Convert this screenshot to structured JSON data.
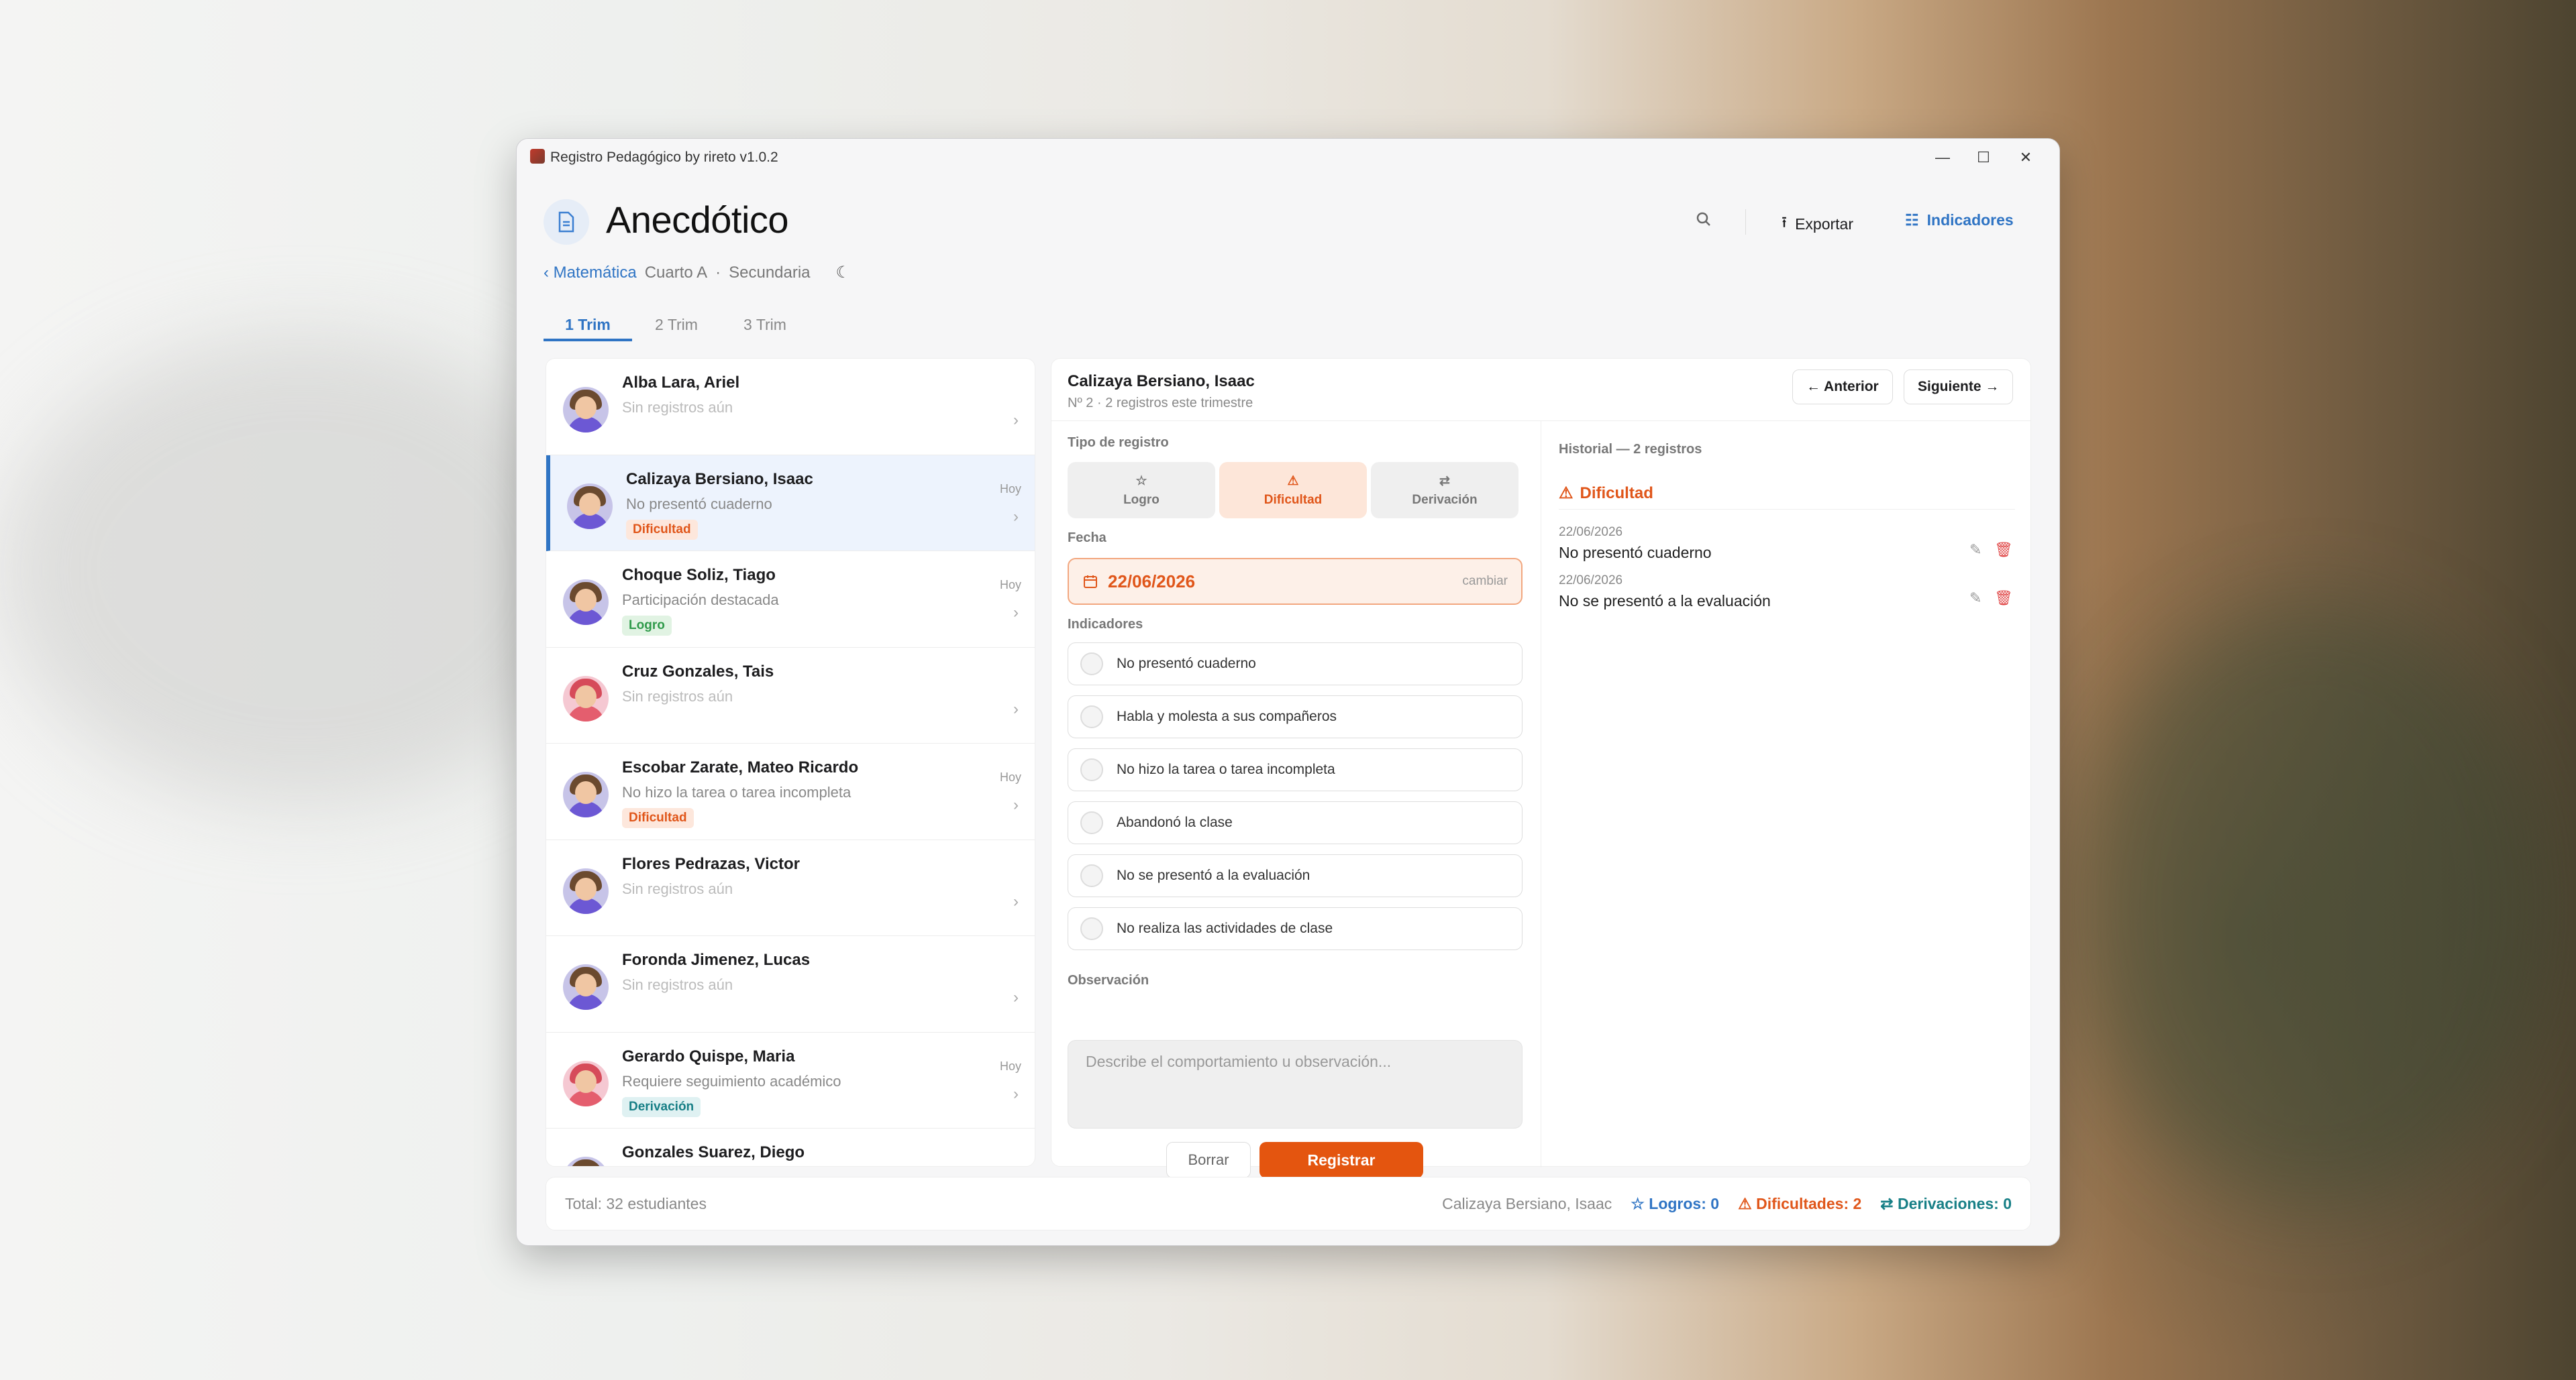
{
  "window": {
    "title": "Registro Pedagógico by rireto v1.0.2",
    "minimize": "—",
    "maximize": "☐",
    "close": "✕"
  },
  "header": {
    "title": "Anecdótico",
    "search_icon": "search-icon",
    "export_label": "Exportar",
    "indicators_label": "Indicadores"
  },
  "breadcrumb": {
    "back": "Matemática",
    "course": "Cuarto A",
    "sep": "·",
    "level": "Secundaria"
  },
  "tabs": [
    "1 Trim",
    "2 Trim",
    "3 Trim"
  ],
  "students": [
    {
      "name": "Alba Lara, Ariel",
      "sub": "Sin registros aún",
      "badge": "",
      "hoy": ""
    },
    {
      "name": "Calizaya Bersiano, Isaac",
      "sub": "No presentó cuaderno",
      "badge": "Dificultad",
      "hoy": "Hoy"
    },
    {
      "name": "Choque Soliz, Tiago",
      "sub": "Participación destacada",
      "badge": "Logro",
      "hoy": "Hoy"
    },
    {
      "name": "Cruz Gonzales, Tais",
      "sub": "Sin registros aún",
      "badge": "",
      "hoy": ""
    },
    {
      "name": "Escobar Zarate, Mateo Ricardo",
      "sub": "No hizo la tarea o tarea incompleta",
      "badge": "Dificultad",
      "hoy": "Hoy"
    },
    {
      "name": "Flores Pedrazas, Victor",
      "sub": "Sin registros aún",
      "badge": "",
      "hoy": ""
    },
    {
      "name": "Foronda Jimenez, Lucas",
      "sub": "Sin registros aún",
      "badge": "",
      "hoy": ""
    },
    {
      "name": "Gerardo Quispe, Maria",
      "sub": "Requiere seguimiento académico",
      "badge": "Derivación",
      "hoy": "Hoy"
    },
    {
      "name": "Gonzales Suarez, Diego",
      "sub": "",
      "badge": "",
      "hoy": ""
    }
  ],
  "detail": {
    "name": "Calizaya Bersiano, Isaac",
    "meta": "Nº 2  ·  2 registros este trimestre",
    "prev": "← Anterior",
    "next": "Siguiente →",
    "type_label": "Tipo de registro",
    "types": [
      "Logro",
      "Dificultad",
      "Derivación"
    ],
    "date_label": "Fecha",
    "date": "22/06/2026",
    "date_change": "cambiar",
    "indicators_label": "Indicadores",
    "indicators": [
      "No presentó cuaderno",
      "Habla y molesta a sus compañeros",
      "No hizo la tarea o tarea incompleta",
      "Abandonó la clase",
      "No se presentó a la evaluación",
      "No realiza las actividades de clase"
    ],
    "obs_label": "Observación",
    "obs_placeholder": "Describe el comportamiento u observación...",
    "clear": "Borrar",
    "submit": "Registrar"
  },
  "history": {
    "title": "Historial — 2 registros",
    "group": "Dificultad",
    "items": [
      {
        "date": "22/06/2026",
        "text": "No presentó cuaderno"
      },
      {
        "date": "22/06/2026",
        "text": "No se presentó a la evaluación"
      }
    ]
  },
  "footer": {
    "total": "Total: 32 estudiantes",
    "current": "Calizaya Bersiano, Isaac",
    "logros": "Logros: 0",
    "dificultades": "Dificultades: 2",
    "derivaciones": "Derivaciones: 0"
  },
  "colors": {
    "accent": "#2f74c4",
    "dificultad": "#e0561a",
    "logro": "#2f9a4a",
    "derivacion": "#177f86"
  }
}
